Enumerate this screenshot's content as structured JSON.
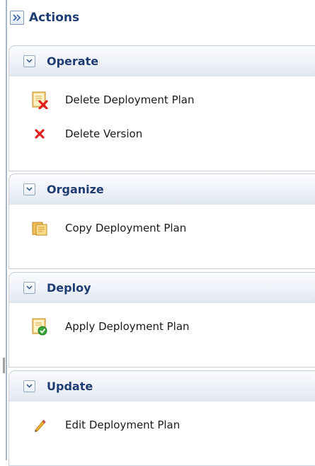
{
  "header": {
    "title": "Actions",
    "expand_icon": "double-chevron-right-icon"
  },
  "panels": [
    {
      "title": "Operate",
      "items": [
        {
          "label": "Delete Deployment Plan",
          "icon": "delete-document-icon"
        },
        {
          "label": "Delete Version",
          "icon": "red-x-icon"
        }
      ]
    },
    {
      "title": "Organize",
      "items": [
        {
          "label": "Copy Deployment Plan",
          "icon": "copy-document-icon"
        }
      ]
    },
    {
      "title": "Deploy",
      "items": [
        {
          "label": "Apply Deployment Plan",
          "icon": "apply-document-icon"
        }
      ]
    },
    {
      "title": "Update",
      "items": [
        {
          "label": "Edit Deployment Plan",
          "icon": "pencil-icon"
        }
      ]
    }
  ],
  "colors": {
    "title": "#1f3d72",
    "panel_border": "#c6cfdb",
    "header_gradient_bottom": "#e2e8f1",
    "delete_red": "#e02020",
    "document_orange": "#e8a02a",
    "apply_green": "#3aa63a"
  }
}
